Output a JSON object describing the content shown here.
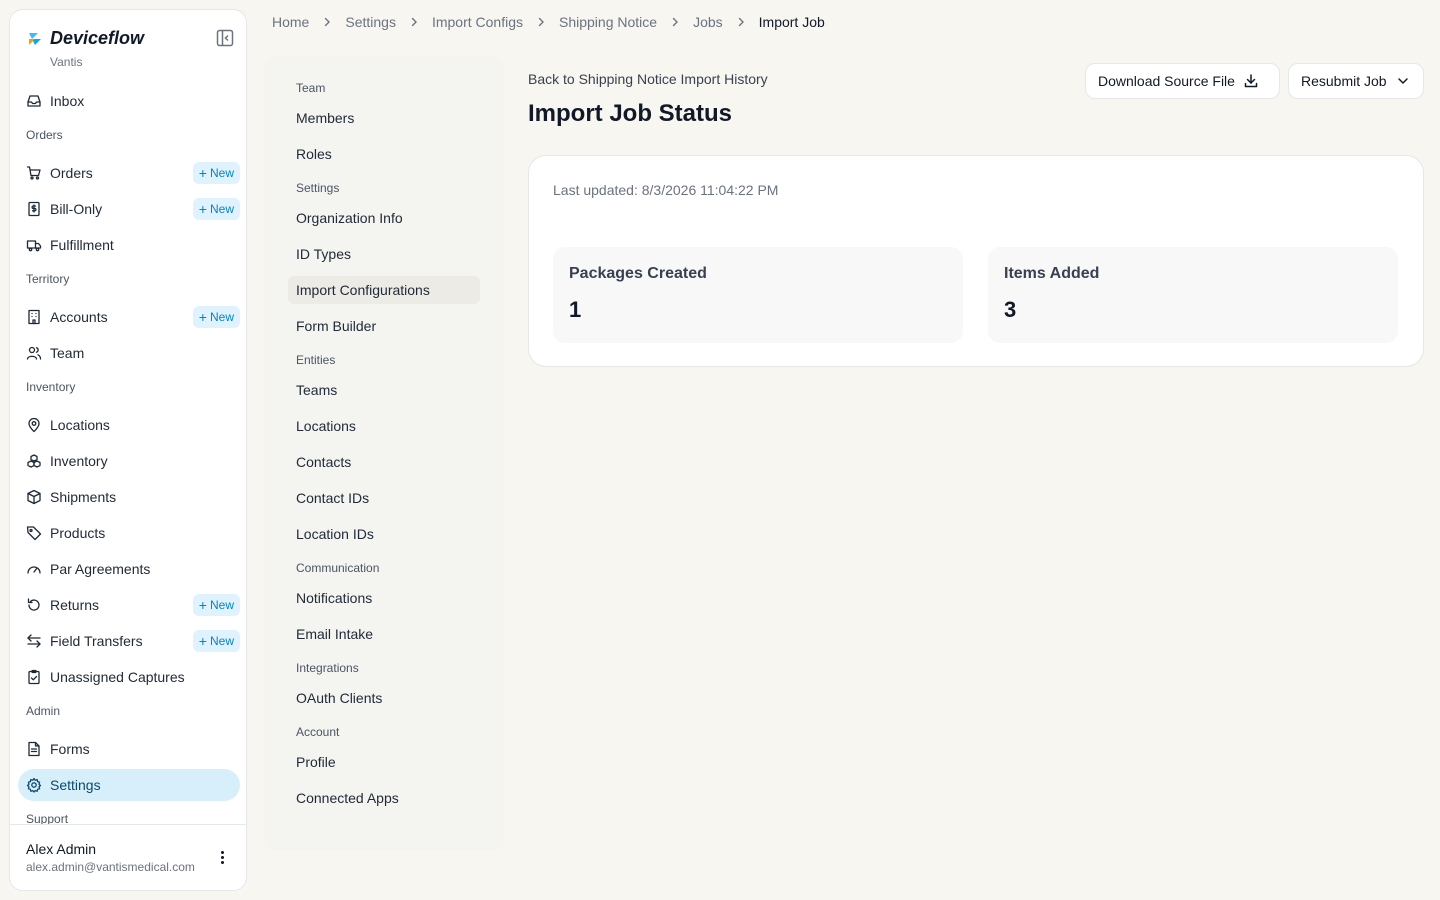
{
  "app": {
    "name": "Deviceflow",
    "org": "Vantis"
  },
  "sidebar": {
    "new_label": "New",
    "entries": [
      {
        "kind": "item",
        "label": "Inbox",
        "icon": "inbox-icon",
        "name": "sidebar-item-inbox"
      },
      {
        "kind": "section",
        "label": "Orders"
      },
      {
        "kind": "item",
        "label": "Orders",
        "icon": "cart-icon",
        "name": "sidebar-item-orders",
        "new": true
      },
      {
        "kind": "item",
        "label": "Bill-Only",
        "icon": "receipt-icon",
        "name": "sidebar-item-bill-only",
        "new": true
      },
      {
        "kind": "item",
        "label": "Fulfillment",
        "icon": "truck-icon",
        "name": "sidebar-item-fulfillment"
      },
      {
        "kind": "section",
        "label": "Territory"
      },
      {
        "kind": "item",
        "label": "Accounts",
        "icon": "building-icon",
        "name": "sidebar-item-accounts",
        "new": true
      },
      {
        "kind": "item",
        "label": "Team",
        "icon": "users-icon",
        "name": "sidebar-item-team"
      },
      {
        "kind": "section",
        "label": "Inventory"
      },
      {
        "kind": "item",
        "label": "Locations",
        "icon": "map-pin-icon",
        "name": "sidebar-item-locations"
      },
      {
        "kind": "item",
        "label": "Inventory",
        "icon": "boxes-icon",
        "name": "sidebar-item-inventory"
      },
      {
        "kind": "item",
        "label": "Shipments",
        "icon": "package-icon",
        "name": "sidebar-item-shipments"
      },
      {
        "kind": "item",
        "label": "Products",
        "icon": "tag-icon",
        "name": "sidebar-item-products"
      },
      {
        "kind": "item",
        "label": "Par Agreements",
        "icon": "gauge-icon",
        "name": "sidebar-item-par-agreements"
      },
      {
        "kind": "item",
        "label": "Returns",
        "icon": "undo-icon",
        "name": "sidebar-item-returns",
        "new": true
      },
      {
        "kind": "item",
        "label": "Field Transfers",
        "icon": "arrows-swap-icon",
        "name": "sidebar-item-field-transfers",
        "new": true
      },
      {
        "kind": "item",
        "label": "Unassigned Captures",
        "icon": "clipboard-check-icon",
        "name": "sidebar-item-unassigned-captures"
      },
      {
        "kind": "section",
        "label": "Admin"
      },
      {
        "kind": "item",
        "label": "Forms",
        "icon": "file-text-icon",
        "name": "sidebar-item-forms"
      },
      {
        "kind": "item",
        "label": "Settings",
        "icon": "gear-icon",
        "name": "sidebar-item-settings",
        "active": true
      },
      {
        "kind": "section",
        "label": "Support"
      }
    ]
  },
  "user": {
    "name": "Alex Admin",
    "email": "alex.admin@vantismedical.com"
  },
  "breadcrumb": [
    "Home",
    "Settings",
    "Import Configs",
    "Shipping Notice",
    "Jobs",
    "Import Job"
  ],
  "settings_nav": [
    {
      "kind": "section",
      "label": "Team"
    },
    {
      "kind": "item",
      "label": "Members"
    },
    {
      "kind": "item",
      "label": "Roles"
    },
    {
      "kind": "section",
      "label": "Settings"
    },
    {
      "kind": "item",
      "label": "Organization Info"
    },
    {
      "kind": "item",
      "label": "ID Types"
    },
    {
      "kind": "item",
      "label": "Import Configurations",
      "active": true
    },
    {
      "kind": "item",
      "label": "Form Builder"
    },
    {
      "kind": "section",
      "label": "Entities"
    },
    {
      "kind": "item",
      "label": "Teams"
    },
    {
      "kind": "item",
      "label": "Locations"
    },
    {
      "kind": "item",
      "label": "Contacts"
    },
    {
      "kind": "item",
      "label": "Contact IDs"
    },
    {
      "kind": "item",
      "label": "Location IDs"
    },
    {
      "kind": "section",
      "label": "Communication"
    },
    {
      "kind": "item",
      "label": "Notifications"
    },
    {
      "kind": "item",
      "label": "Email Intake"
    },
    {
      "kind": "section",
      "label": "Integrations"
    },
    {
      "kind": "item",
      "label": "OAuth Clients"
    },
    {
      "kind": "section",
      "label": "Account"
    },
    {
      "kind": "item",
      "label": "Profile"
    },
    {
      "kind": "item",
      "label": "Connected Apps"
    }
  ],
  "main": {
    "back_link": "Back to Shipping Notice Import History",
    "title": "Import Job Status",
    "download_label": "Download Source File",
    "resubmit_label": "Resubmit Job",
    "last_updated": "Last updated: 8/3/2026 11:04:22 PM",
    "stats": [
      {
        "label": "Packages Created",
        "value": "1"
      },
      {
        "label": "Items Added",
        "value": "3"
      }
    ]
  },
  "colors": {
    "accent": "#0284c7",
    "active_bg": "#d6effa",
    "page_bg": "#f7f6f1"
  }
}
